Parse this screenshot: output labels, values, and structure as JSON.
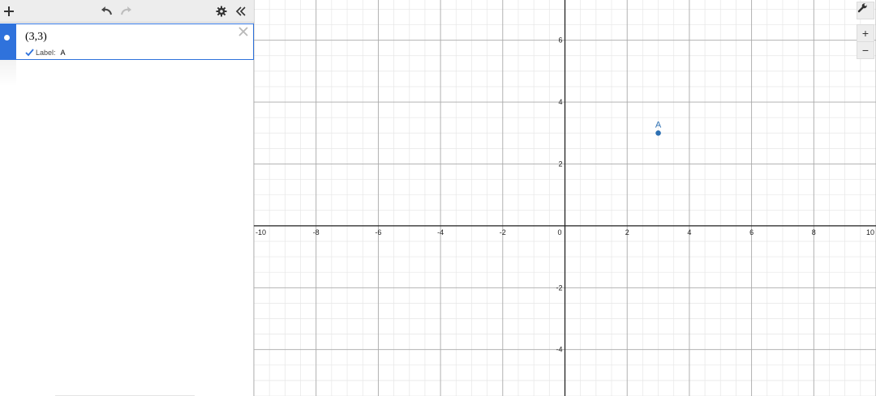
{
  "toolbar": {
    "add_icon": "plus-icon",
    "undo_icon": "undo-icon",
    "redo_icon": "redo-icon",
    "settings_icon": "gear-icon",
    "collapse_icon": "double-chevron-left-icon"
  },
  "expressions": [
    {
      "latex": "(3,3)",
      "selected": true,
      "color": "#2d70b3",
      "label_option_text": "Label:",
      "label_checked": true,
      "label_value": "A"
    }
  ],
  "graph_controls": {
    "wrench_icon": "wrench-icon",
    "zoom_in": "+",
    "zoom_out": "−"
  },
  "chart_data": {
    "type": "scatter",
    "xlim": [
      -10,
      10
    ],
    "ylim": [
      -5.5,
      7.3
    ],
    "grid": true,
    "x_ticks": [
      "-10",
      "-8",
      "-6",
      "-4",
      "-2",
      "0",
      "2",
      "4",
      "6",
      "8",
      "10"
    ],
    "y_ticks": [
      "6",
      "4",
      "2",
      "-2",
      "-4"
    ],
    "points": [
      {
        "x": 3,
        "y": 3,
        "label": "A",
        "color": "#2d70b3"
      }
    ]
  }
}
